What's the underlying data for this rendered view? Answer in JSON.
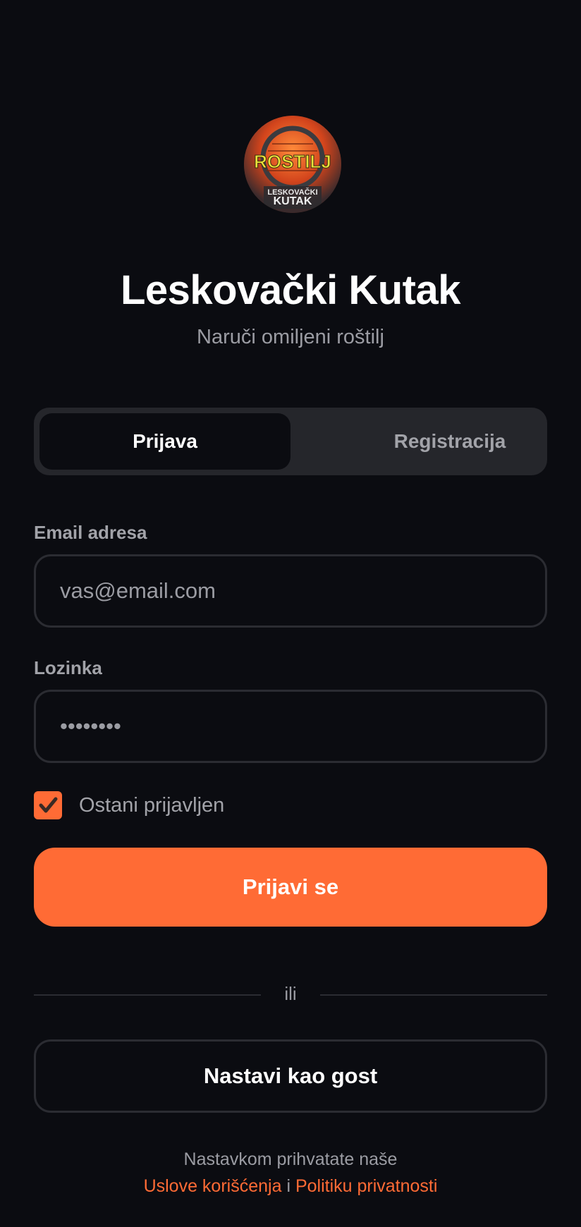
{
  "brand": {
    "logo_text_main": "ROSTILJ",
    "logo_text_sub1": "LESKOVAČKI",
    "logo_text_sub2": "KUTAK",
    "title": "Leskovački Kutak",
    "subtitle": "Naruči omiljeni roštilj"
  },
  "tabs": {
    "login": "Prijava",
    "register": "Registracija",
    "active": "login"
  },
  "form": {
    "email_label": "Email adresa",
    "email_placeholder": "vas@email.com",
    "password_label": "Lozinka",
    "password_value": "••••••••",
    "remember_label": "Ostani prijavljen",
    "remember_checked": true,
    "submit_label": "Prijavi se"
  },
  "divider": {
    "text": "ili"
  },
  "guest": {
    "label": "Nastavi kao gost"
  },
  "terms": {
    "prefix": "Nastavkom prihvatate naše",
    "terms_link": "Uslove korišćenja",
    "conjunction": "i",
    "privacy_link": "Politiku privatnosti"
  },
  "colors": {
    "background": "#0b0c11",
    "accent": "#ff6b35",
    "muted_text": "#9b9ca3",
    "tab_bar": "#25262b",
    "border": "#2b2c32"
  }
}
